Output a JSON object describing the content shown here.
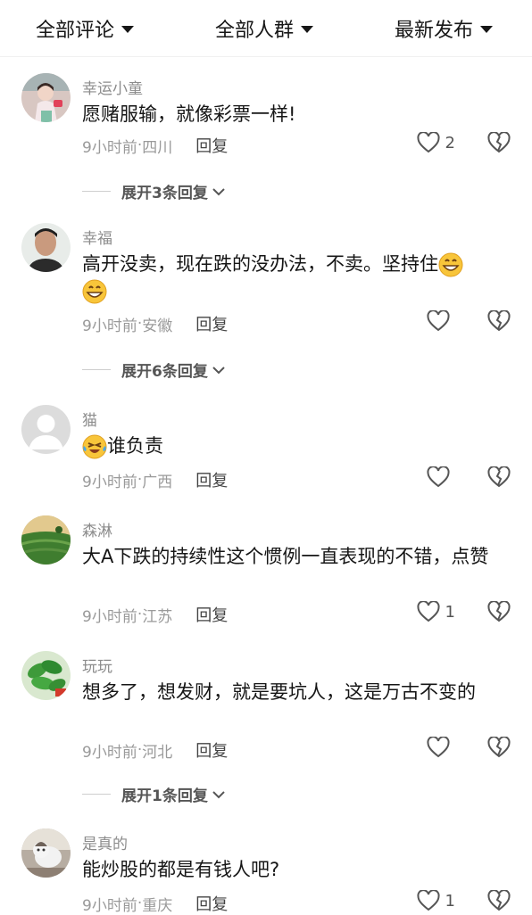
{
  "filters": {
    "all_comments": "全部评论",
    "all_people": "全部人群",
    "latest": "最新发布"
  },
  "comments": [
    {
      "nick": "幸运小童",
      "text": "愿赌服输，就像彩票一样!",
      "time": "9小时前",
      "location": "四川",
      "reply_label": "回复",
      "likes": "2",
      "expand": "展开3条回复"
    },
    {
      "nick": "幸福",
      "text": "高开没卖，现在跌的没办法，不卖。坚持住",
      "time": "9小时前",
      "location": "安徽",
      "reply_label": "回复",
      "likes": "",
      "expand": "展开6条回复"
    },
    {
      "nick": "猫",
      "text": "谁负责",
      "time": "9小时前",
      "location": "广西",
      "reply_label": "回复",
      "likes": "",
      "expand": ""
    },
    {
      "nick": "森淋",
      "text": "大A下跌的持续性这个惯例一直表现的不错，点赞",
      "time": "9小时前",
      "location": "江苏",
      "reply_label": "回复",
      "likes": "1",
      "expand": ""
    },
    {
      "nick": "玩玩",
      "text": "想多了，想发财，就是要坑人，这是万古不变的",
      "time": "9小时前",
      "location": "河北",
      "reply_label": "回复",
      "likes": "",
      "expand": "展开1条回复"
    },
    {
      "nick": "是真的",
      "text": "能炒股的都是有钱人吧?",
      "time": "9小时前",
      "location": "重庆",
      "reply_label": "回复",
      "likes": "1",
      "expand": ""
    }
  ],
  "separator": "·"
}
